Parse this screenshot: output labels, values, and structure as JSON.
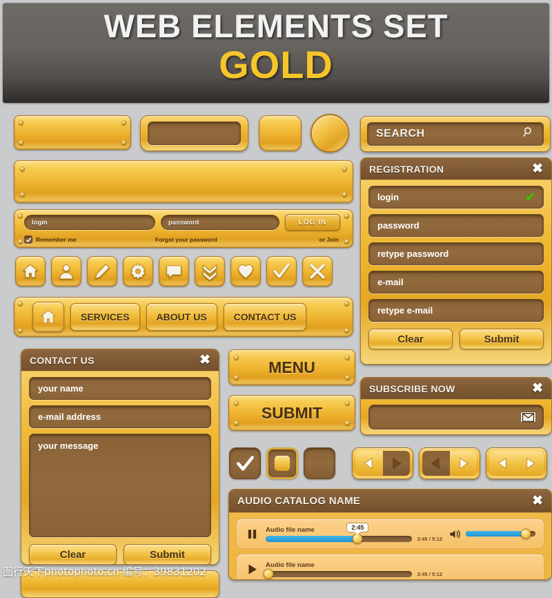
{
  "banner": {
    "title": "WEB ELEMENTS SET",
    "subtitle": "GOLD",
    "title_color": "#f2f2f2",
    "subtitle_color": "#f5c52a",
    "background_color": "#67635f"
  },
  "palette": {
    "page_background": "#c9cbcc",
    "gold_light": "#fbe08a",
    "gold_mid": "#f0bd3d",
    "gold_dark": "#e0a021",
    "gold_border": "#a9711a",
    "brown_field": "#8a6237",
    "brown_header": "#7e5833",
    "check_green": "#3fc000",
    "slider_blue": "#1f94d4",
    "text_dark": "#4a3210",
    "text_light": "#f3efe6"
  },
  "search": {
    "value": "SEARCH",
    "icon": "search-icon"
  },
  "login_bar": {
    "username_value": "login",
    "password_value": "password",
    "submit_label": "LOG IN",
    "remember_label": "Remember me",
    "remember_checked": true,
    "forgot_label": "Forgot your password",
    "join_label": "or Join"
  },
  "icon_row": [
    {
      "name": "home-icon"
    },
    {
      "name": "user-icon"
    },
    {
      "name": "pencil-icon"
    },
    {
      "name": "gear-icon"
    },
    {
      "name": "speech-bubble-icon"
    },
    {
      "name": "double-chevron-down-icon"
    },
    {
      "name": "heart-icon"
    },
    {
      "name": "check-icon"
    },
    {
      "name": "close-x-icon"
    }
  ],
  "nav": {
    "home_icon": "home-icon",
    "items": [
      {
        "label": "SERVICES"
      },
      {
        "label": "ABOUT US"
      },
      {
        "label": "CONTACT US"
      }
    ]
  },
  "registration": {
    "title": "REGISTRATION",
    "close_label": "✖",
    "fields": [
      {
        "value": "login",
        "validated": true,
        "check_mark": "✔"
      },
      {
        "value": "password",
        "validated": false
      },
      {
        "value": "retype password",
        "validated": false
      },
      {
        "value": "e-mail",
        "validated": false
      },
      {
        "value": "retype e-mail",
        "validated": false
      }
    ],
    "clear_label": "Clear",
    "submit_label": "Submit"
  },
  "subscribe": {
    "title": "SUBSCRIBE NOW",
    "close_label": "✖",
    "input_value": "",
    "icon": "envelope-icon"
  },
  "contact": {
    "title": "CONTACT US",
    "close_label": "✖",
    "name_value": "your name",
    "email_value": "e-mail address",
    "message_value": "your message",
    "clear_label": "Clear",
    "submit_label": "Submit"
  },
  "big_buttons": {
    "menu_label": "MENU",
    "submit_label": "SUBMIT"
  },
  "toggles": [
    {
      "name": "checkbox-checked",
      "state": "checked"
    },
    {
      "name": "checkbox-filled",
      "state": "filled"
    },
    {
      "name": "checkbox-empty",
      "state": "empty"
    }
  ],
  "arrow_pairs": [
    {
      "prev_active": true,
      "next_active": false
    },
    {
      "prev_active": false,
      "next_active": true
    },
    {
      "prev_active": true,
      "next_active": true
    }
  ],
  "audio": {
    "title": "AUDIO CATALOG NAME",
    "close_label": "✖",
    "tracks": [
      {
        "name": "Audio file name",
        "state": "playing",
        "button_icon": "pause-icon",
        "tooltip": "2:45",
        "time": "2:45 / 5:12",
        "progress_percent": 63,
        "volume_percent": 86,
        "volume_icon": "speaker-icon"
      },
      {
        "name": "Audio file name",
        "state": "paused",
        "button_icon": "play-icon",
        "tooltip": "",
        "time": "2:45 / 5:12",
        "progress_percent": 2
      }
    ]
  },
  "watermark": {
    "text": "图行天下photophoto.cn  编号：39831202"
  }
}
